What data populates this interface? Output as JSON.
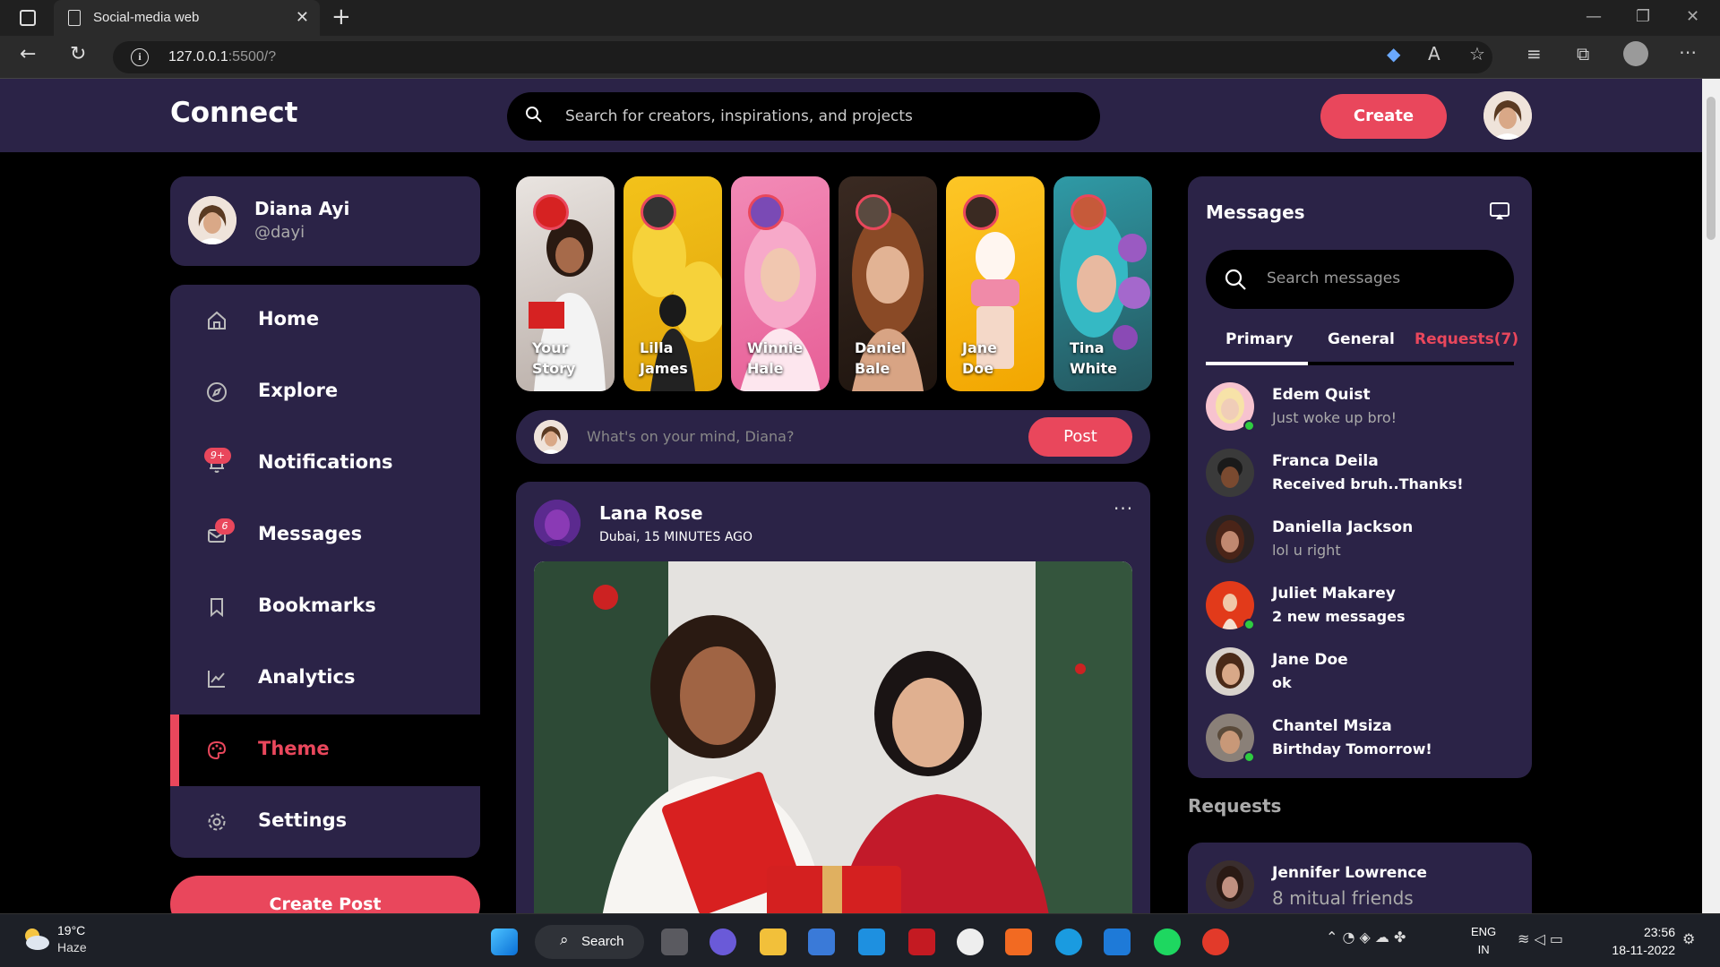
{
  "browser": {
    "tab_title": "Social-media web",
    "url_host": "127.0.0.1",
    "url_rest": ":5500/?"
  },
  "nav": {
    "logo": "Connect",
    "search_placeholder": "Search for creators, inspirations, and projects",
    "create_label": "Create"
  },
  "profile": {
    "name": "Diana Ayi",
    "handle": "@dayi"
  },
  "sidebar": {
    "items": [
      {
        "label": "Home",
        "icon": "home-icon"
      },
      {
        "label": "Explore",
        "icon": "compass-icon"
      },
      {
        "label": "Notifications",
        "icon": "bell-icon",
        "badge": "9+"
      },
      {
        "label": "Messages",
        "icon": "envelope-icon",
        "badge": "6"
      },
      {
        "label": "Bookmarks",
        "icon": "bookmark-icon"
      },
      {
        "label": "Analytics",
        "icon": "chart-icon"
      },
      {
        "label": "Theme",
        "icon": "palette-icon",
        "active": true
      },
      {
        "label": "Settings",
        "icon": "gear-icon"
      }
    ],
    "create_post_label": "Create Post"
  },
  "stories": [
    {
      "line1": "Your",
      "line2": "Story"
    },
    {
      "line1": "Lilla",
      "line2": "James"
    },
    {
      "line1": "Winnie",
      "line2": "Hale"
    },
    {
      "line1": "Daniel",
      "line2": "Bale"
    },
    {
      "line1": "Jane",
      "line2": "Doe"
    },
    {
      "line1": "Tina",
      "line2": "White"
    }
  ],
  "composer": {
    "placeholder": "What's on your mind, Diana?",
    "post_label": "Post"
  },
  "feed": {
    "author": "Lana Rose",
    "location": "Dubai, 15 MINUTES AGO",
    "more": "..."
  },
  "messages": {
    "title": "Messages",
    "search_placeholder": "Search messages",
    "tabs": [
      "Primary",
      "General",
      "Requests(7)"
    ],
    "rows": [
      {
        "name": "Edem Quist",
        "text": "Just woke up bro!"
      },
      {
        "name": "Franca Deila",
        "text": "Received bruh..Thanks!"
      },
      {
        "name": "Daniella Jackson",
        "text": "lol u right"
      },
      {
        "name": "Juliet Makarey",
        "text": "2 new messages"
      },
      {
        "name": "Jane Doe",
        "text": "ok"
      },
      {
        "name": "Chantel Msiza",
        "text": "Birthday Tomorrow!"
      }
    ]
  },
  "requests": {
    "title": "Requests",
    "name": "Jennifer Lowrence",
    "text": "8 mitual friends"
  },
  "taskbar": {
    "temp": "19°C",
    "condition": "Haze",
    "search_label": "Search",
    "lang1": "ENG",
    "lang2": "IN",
    "time": "23:56",
    "date": "18-11-2022"
  },
  "colors": {
    "accent": "#e9475c",
    "card": "#2b2347",
    "online": "#2ecc40"
  }
}
